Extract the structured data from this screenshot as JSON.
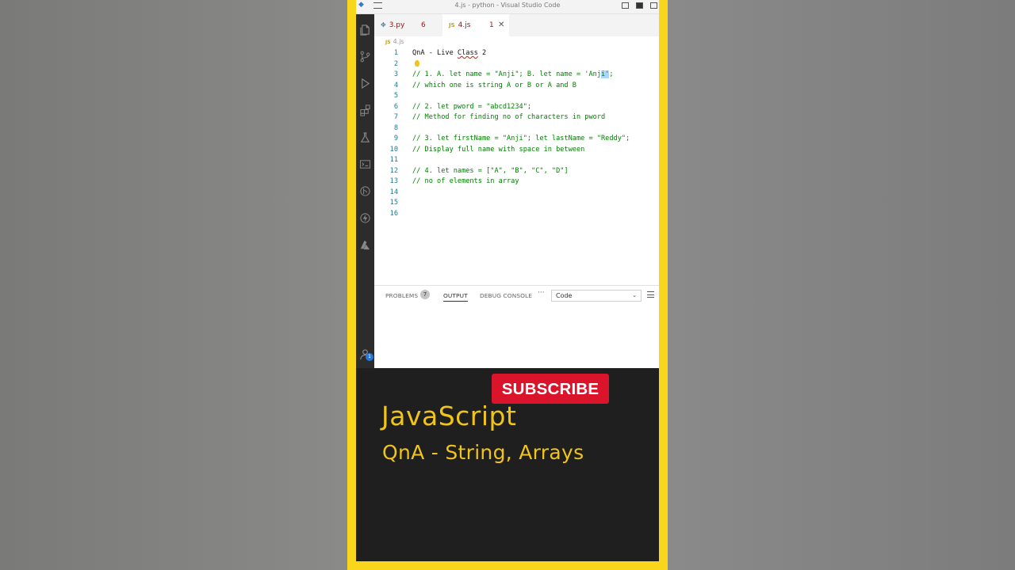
{
  "window": {
    "title": "4.js - python - Visual Studio Code"
  },
  "tabs": [
    {
      "label": "3.py",
      "problems": "6"
    },
    {
      "label": "4.js",
      "problems": "1"
    }
  ],
  "breadcrumb": "4.js",
  "code_lines": [
    {
      "n": "1",
      "text": "QnA - Live Class 2"
    },
    {
      "n": "2",
      "text": ""
    },
    {
      "n": "3",
      "text": "// 1. A. let name = \"Anji\"; B. let name = 'Anji';"
    },
    {
      "n": "4",
      "text": "// which one is string A or B or A and B"
    },
    {
      "n": "5",
      "text": ""
    },
    {
      "n": "6",
      "text": "// 2. let pword = \"abcd1234\";"
    },
    {
      "n": "7",
      "text": "// Method for finding no of characters in pword"
    },
    {
      "n": "8",
      "text": ""
    },
    {
      "n": "9",
      "text": "// 3. let firstName = \"Anji\"; let lastName = \"Reddy\";"
    },
    {
      "n": "10",
      "text": "// Display full name with space in between"
    },
    {
      "n": "11",
      "text": ""
    },
    {
      "n": "12",
      "text": "// 4. let names = [\"A\", \"B\", \"C\", \"D\"]"
    },
    {
      "n": "13",
      "text": "// no of elements in array"
    },
    {
      "n": "14",
      "text": ""
    },
    {
      "n": "15",
      "text": ""
    },
    {
      "n": "16",
      "text": ""
    }
  ],
  "line1_parts": {
    "a": "QnA - Live ",
    "b": "Class",
    "c": " 2"
  },
  "line3_parts": {
    "a": "// 1. A. let name = \"Anji\"; B. let name = 'Anj",
    "b": "i'",
    "c": ";"
  },
  "panel": {
    "problems_label": "PROBLEMS",
    "problems_count": "7",
    "output_label": "OUTPUT",
    "debug_label": "DEBUG CONSOLE",
    "more": "···",
    "select_value": "Code"
  },
  "accounts_badge": "1",
  "overlay": {
    "subscribe": "SUBSCRIBE",
    "title": "JavaScript",
    "subtitle": "QnA - String, Arrays"
  },
  "colors": {
    "frame": "#f7d61c",
    "caption": "#f0c419",
    "subscribe_bg": "#d9142b",
    "comment": "#008000"
  }
}
